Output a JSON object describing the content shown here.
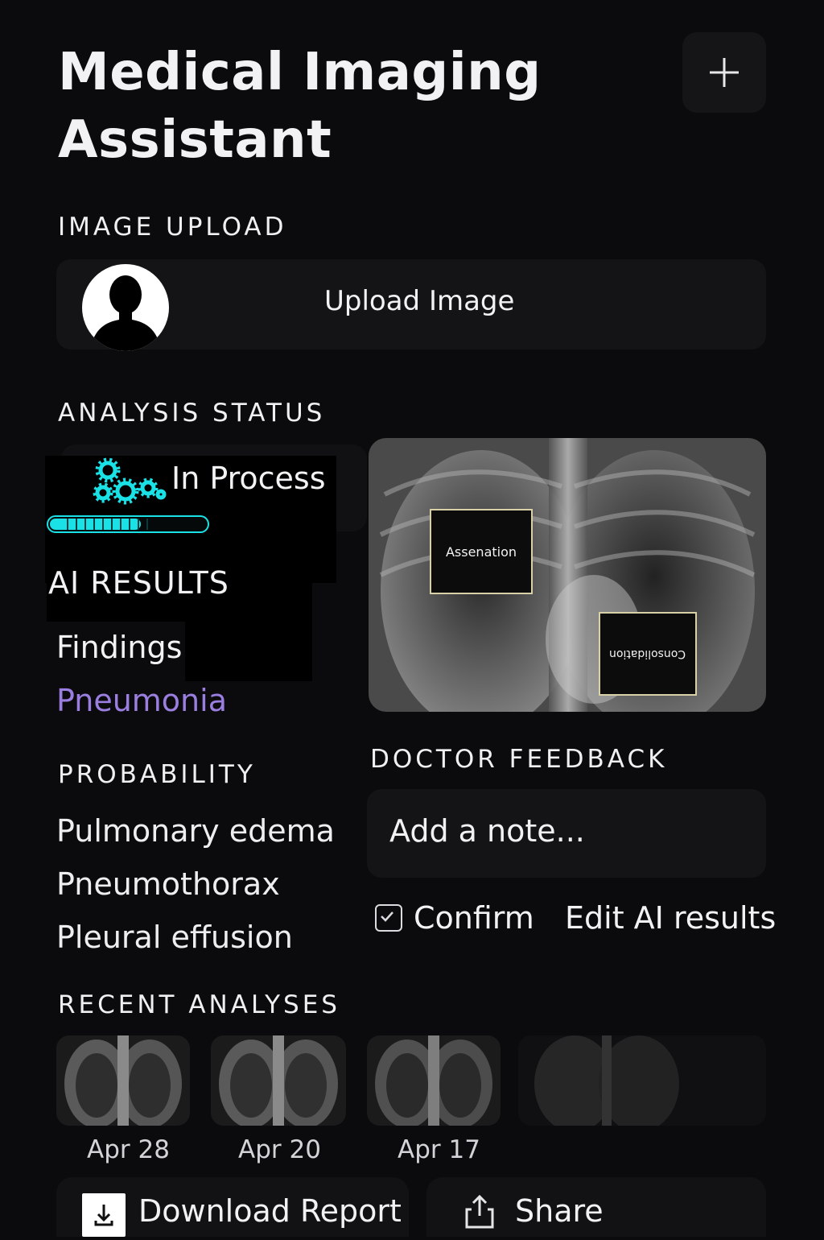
{
  "header": {
    "title": "Medical Imaging Assistant",
    "add_icon": "plus-icon"
  },
  "upload": {
    "section_label": "IMAGE UPLOAD",
    "button_label": "Upload Image",
    "avatar_icon": "person-silhouette-icon"
  },
  "status": {
    "section_label": "ANALYSIS STATUS",
    "state_text": "In Process",
    "icon": "gears-icon",
    "progress_fraction": 0.58,
    "accent_color": "#19e1e6"
  },
  "xray": {
    "annotations": [
      {
        "label": "Assenation"
      },
      {
        "label": "Consolidation"
      }
    ]
  },
  "ai_results": {
    "section_label": "AI RESULTS",
    "findings_label": "Findings",
    "finding_value": "Pneumonia",
    "finding_color": "#9a7ee0"
  },
  "probability": {
    "section_label": "PROBABILITY",
    "items": [
      "Pulmonary edema",
      "Pneumothorax",
      "Pleural effusion"
    ]
  },
  "feedback": {
    "section_label": "DOCTOR FEEDBACK",
    "placeholder": "Add a note...",
    "confirm_label": "Confirm",
    "edit_label": "Edit AI results"
  },
  "recent": {
    "section_label": "RECENT ANALYSES",
    "items": [
      {
        "date": "Apr 28"
      },
      {
        "date": "Apr 20"
      },
      {
        "date": "Apr 17"
      },
      {
        "date": ""
      }
    ]
  },
  "actions": {
    "download_label": "Download Report",
    "share_label": "Share"
  }
}
